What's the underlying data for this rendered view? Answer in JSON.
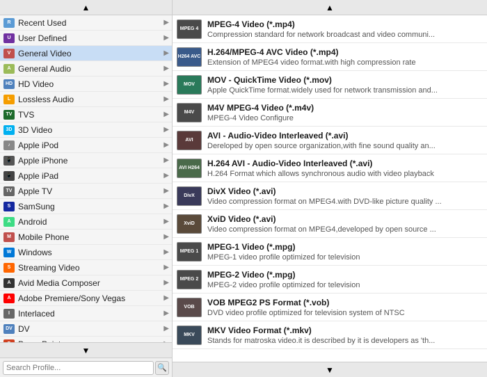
{
  "left": {
    "scroll_up_label": "▲",
    "scroll_down_label": "▼",
    "items": [
      {
        "id": "recent-used",
        "label": "Recent Used",
        "icon_class": "ic-recent",
        "icon_text": "R",
        "active": false
      },
      {
        "id": "user-defined",
        "label": "User Defined",
        "icon_class": "ic-user",
        "icon_text": "U",
        "active": false
      },
      {
        "id": "general-video",
        "label": "General Video",
        "icon_class": "ic-general-video",
        "icon_text": "V",
        "active": true
      },
      {
        "id": "general-audio",
        "label": "General Audio",
        "icon_class": "ic-general-audio",
        "icon_text": "A",
        "active": false
      },
      {
        "id": "hd-video",
        "label": "HD Video",
        "icon_class": "ic-hd",
        "icon_text": "HD",
        "active": false
      },
      {
        "id": "lossless-audio",
        "label": "Lossless Audio",
        "icon_class": "ic-lossless",
        "icon_text": "L",
        "active": false
      },
      {
        "id": "tvs",
        "label": "TVS",
        "icon_class": "ic-tvs",
        "icon_text": "TV",
        "active": false
      },
      {
        "id": "3d-video",
        "label": "3D Video",
        "icon_class": "ic-3d",
        "icon_text": "3D",
        "active": false
      },
      {
        "id": "apple-ipod",
        "label": "Apple iPod",
        "icon_class": "ic-ipod",
        "icon_text": "♪",
        "active": false
      },
      {
        "id": "apple-iphone",
        "label": "Apple iPhone",
        "icon_class": "ic-iphone",
        "icon_text": "📱",
        "active": false
      },
      {
        "id": "apple-ipad",
        "label": "Apple iPad",
        "icon_class": "ic-ipad",
        "icon_text": "📱",
        "active": false
      },
      {
        "id": "apple-tv",
        "label": "Apple TV",
        "icon_class": "ic-appletv",
        "icon_text": "TV",
        "active": false
      },
      {
        "id": "samsung",
        "label": "SamSung",
        "icon_class": "ic-samsung",
        "icon_text": "S",
        "active": false
      },
      {
        "id": "android",
        "label": "Android",
        "icon_class": "ic-android",
        "icon_text": "A",
        "active": false
      },
      {
        "id": "mobile-phone",
        "label": "Mobile Phone",
        "icon_class": "ic-mobile",
        "icon_text": "M",
        "active": false
      },
      {
        "id": "windows",
        "label": "Windows",
        "icon_class": "ic-windows",
        "icon_text": "W",
        "active": false
      },
      {
        "id": "streaming-video",
        "label": "Streaming Video",
        "icon_class": "ic-streaming",
        "icon_text": "S",
        "active": false
      },
      {
        "id": "avid-media",
        "label": "Avid Media Composer",
        "icon_class": "ic-avid",
        "icon_text": "A",
        "active": false
      },
      {
        "id": "adobe-premiere",
        "label": "Adobe Premiere/Sony Vegas",
        "icon_class": "ic-adobe",
        "icon_text": "A",
        "active": false
      },
      {
        "id": "interlaced",
        "label": "Interlaced",
        "icon_class": "ic-interlaced",
        "icon_text": "I",
        "active": false
      },
      {
        "id": "dv",
        "label": "DV",
        "icon_class": "ic-dv",
        "icon_text": "DV",
        "active": false
      },
      {
        "id": "powerpoint",
        "label": "PowerPoint",
        "icon_class": "ic-ppt",
        "icon_text": "P",
        "active": false
      }
    ],
    "search_placeholder": "Search Profile..."
  },
  "right": {
    "scroll_up_label": "▲",
    "scroll_down_label": "▼",
    "items": [
      {
        "id": "mpeg4",
        "icon_class": "vid-mpeg4",
        "icon_text": "MPEG\n4",
        "title": "MPEG-4 Video (*.mp4)",
        "desc": "Compression standard for network broadcast and video communi..."
      },
      {
        "id": "h264-mp4",
        "icon_class": "vid-h264",
        "icon_text": "H264\nAVC",
        "title": "H.264/MPEG-4 AVC Video (*.mp4)",
        "desc": "Extension of MPEG4 video format.with high compression rate"
      },
      {
        "id": "mov",
        "icon_class": "vid-mov",
        "icon_text": "MOV",
        "title": "MOV - QuickTime Video (*.mov)",
        "desc": "Apple QuickTime format.widely used for network transmission and..."
      },
      {
        "id": "m4v",
        "icon_class": "vid-m4v",
        "icon_text": "M4V",
        "title": "M4V MPEG-4 Video (*.m4v)",
        "desc": "MPEG-4 Video Configure"
      },
      {
        "id": "avi",
        "icon_class": "vid-avi",
        "icon_text": "AVI",
        "title": "AVI - Audio-Video Interleaved (*.avi)",
        "desc": "Dereloped by open source organization,with fine sound quality an..."
      },
      {
        "id": "h264-avi",
        "icon_class": "vid-h264avi",
        "icon_text": "AVI\nH264",
        "title": "H.264 AVI - Audio-Video Interleaved (*.avi)",
        "desc": "H.264 Format which allows synchronous audio with video playback"
      },
      {
        "id": "divx",
        "icon_class": "vid-divx",
        "icon_text": "DivX",
        "title": "DivX Video (*.avi)",
        "desc": "Video compression format on MPEG4.with DVD-like picture quality ..."
      },
      {
        "id": "xvid",
        "icon_class": "vid-xvid",
        "icon_text": "XviD",
        "title": "XviD Video (*.avi)",
        "desc": "Video compression format on MPEG4,developed by open source ..."
      },
      {
        "id": "mpeg1",
        "icon_class": "vid-mpeg1",
        "icon_text": "MPEG\n1",
        "title": "MPEG-1 Video (*.mpg)",
        "desc": "MPEG-1 video profile optimized for television"
      },
      {
        "id": "mpeg2",
        "icon_class": "vid-mpeg2",
        "icon_text": "MPEG\n2",
        "title": "MPEG-2 Video (*.mpg)",
        "desc": "MPEG-2 video profile optimized for television"
      },
      {
        "id": "vob",
        "icon_class": "vid-vob",
        "icon_text": "VOB",
        "title": "VOB MPEG2 PS Format (*.vob)",
        "desc": "DVD video profile optimized for television system of NTSC"
      },
      {
        "id": "mkv",
        "icon_class": "vid-mkv",
        "icon_text": "MKV",
        "title": "MKV Video Format (*.mkv)",
        "desc": "Stands for matroska video.it is described by it is developers as 'th..."
      }
    ]
  }
}
